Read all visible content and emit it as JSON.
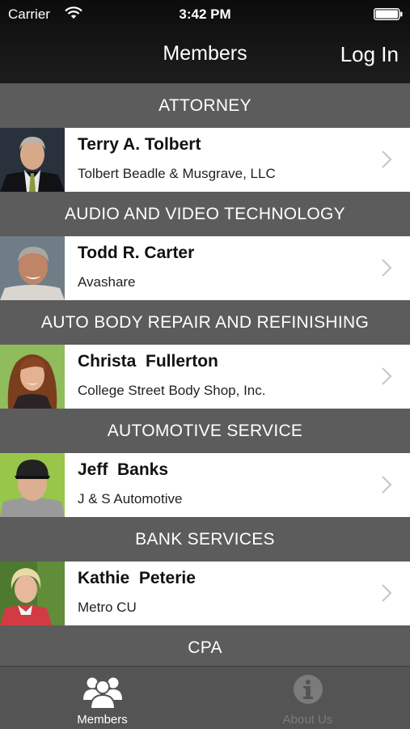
{
  "status_bar": {
    "carrier": "Carrier",
    "time": "3:42 PM"
  },
  "nav": {
    "title": "Members",
    "login_label": "Log In"
  },
  "sections": [
    {
      "header": "ATTORNEY",
      "member": {
        "name": "Terry A. Tolbert",
        "company": "Tolbert Beadle & Musgrave, LLC"
      }
    },
    {
      "header": "AUDIO AND VIDEO TECHNOLOGY",
      "member": {
        "name": "Todd R. Carter",
        "company": "Avashare"
      }
    },
    {
      "header": "AUTO BODY REPAIR AND REFINISHING",
      "member": {
        "name": "Christa  Fullerton",
        "company": "College Street Body Shop, Inc."
      }
    },
    {
      "header": "AUTOMOTIVE SERVICE",
      "member": {
        "name": "Jeff  Banks",
        "company": "J & S Automotive"
      }
    },
    {
      "header": "BANK SERVICES",
      "member": {
        "name": "Kathie  Peterie",
        "company": "Metro CU"
      }
    },
    {
      "header": "CPA"
    }
  ],
  "tabs": [
    {
      "label": "Members",
      "icon": "members-group-icon",
      "selected": true
    },
    {
      "label": "About Us",
      "icon": "info-icon",
      "selected": false
    }
  ],
  "colors": {
    "header_bg": "#141414",
    "section_bg": "#5c5c5c",
    "tabbar_bg": "#545454",
    "tab_selected": "#ffffff",
    "tab_unselected": "#7b7b7b"
  }
}
